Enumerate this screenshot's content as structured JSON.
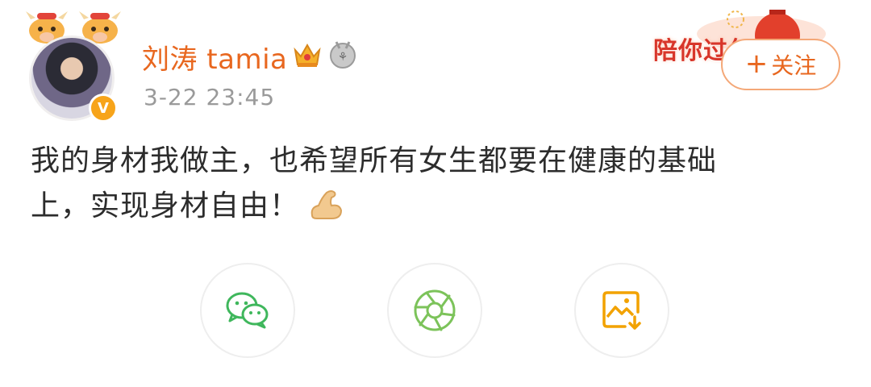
{
  "post": {
    "username": "刘涛 tamia",
    "timestamp": "3-22 23:45",
    "content_line1": "我的身材我做主，也希望所有女生都要在健康的基础",
    "content_line2": "上，实现身材自由！"
  },
  "header": {
    "follow_plus": "+",
    "follow_label": "关注",
    "promo_text": "陪你过年"
  },
  "badges": {
    "verified_symbol": "V",
    "verified_color": "#f7a41a"
  },
  "icons": {
    "avatar_decoration": "ox-icon",
    "crown": "crown-icon",
    "medal": "medal-icon",
    "emoji": "flexed-biceps-icon",
    "share_wechat": "wechat-icon",
    "share_moments": "moments-icon",
    "save_image": "save-image-icon"
  },
  "colors": {
    "username": "#e8671f",
    "timestamp": "#9a9a9a",
    "wechat_green": "#3fb75c",
    "moments_green": "#7cc35a",
    "save_orange": "#f2a200"
  }
}
